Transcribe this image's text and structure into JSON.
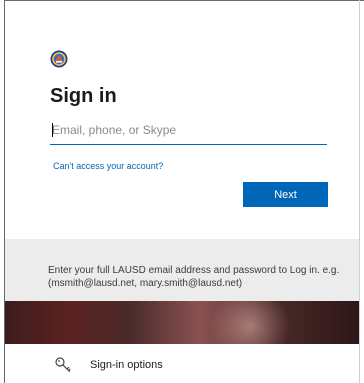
{
  "signin": {
    "title": "Sign in",
    "input_placeholder": "Email, phone, or Skype",
    "input_value": "",
    "cant_access_link": "Can't access your account?",
    "next_label": "Next"
  },
  "info": {
    "text": "Enter your full LAUSD email address and password to Log in. e.g. (msmith@lausd.net, mary.smith@lausd.net)"
  },
  "options": {
    "label": "Sign-in options"
  },
  "colors": {
    "accent": "#0067b8",
    "info_bg": "#ececec"
  },
  "icons": {
    "logo": "lausd-seal-icon",
    "options": "key-icon"
  }
}
